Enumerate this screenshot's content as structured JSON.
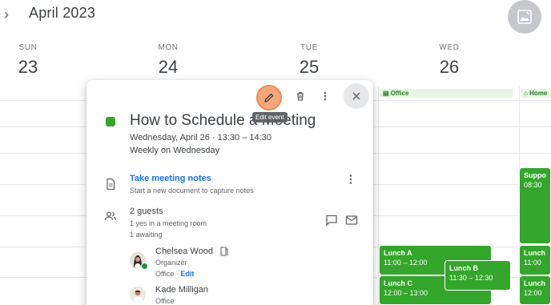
{
  "header": {
    "month_title": "April 2023"
  },
  "days": [
    {
      "dow": "SUN",
      "num": "23"
    },
    {
      "dow": "MON",
      "num": "24"
    },
    {
      "dow": "TUE",
      "num": "25"
    },
    {
      "dow": "WED",
      "num": "26"
    }
  ],
  "all_day": {
    "wed_label": "Office",
    "thu_label": "Home"
  },
  "events": {
    "support": {
      "title": "Suppo",
      "time": "08:30"
    },
    "lunch_a": {
      "title": "Lunch A",
      "time": "11:00 – 12:00"
    },
    "lunch_b": {
      "title": "Lunch B",
      "time": "11:30 – 12:30"
    },
    "lunch_c": {
      "title": "Lunch C",
      "time": "12:00 – 13:00"
    },
    "lunch_right_1": {
      "title": "Lunch",
      "time": "11:00"
    },
    "lunch_right_2": {
      "title": "Lunch",
      "time": "12:00"
    }
  },
  "popup": {
    "tooltip": "Edit event",
    "title": "How to Schedule a Meeting",
    "date_line": "Wednesday, April 26  ·  13:30 – 14:30",
    "recurrence": "Weekly on Wednesday",
    "notes_link": "Take meeting notes",
    "notes_sub": "Start a new document to capture notes",
    "guests_count": "2 guests",
    "guests_sub1": "1 yes in a meeting room",
    "guests_sub2": "1 awaiting",
    "guest1": {
      "name": "Chelsea Wood",
      "role": "Organizer",
      "location": "Office",
      "edit": "Edit"
    },
    "guest2": {
      "name": "Kade Milligan",
      "location": "Office"
    }
  },
  "colors": {
    "event_green": "#33a62b",
    "link_blue": "#1a73e8",
    "edit_highlight": "#f4a77a"
  }
}
